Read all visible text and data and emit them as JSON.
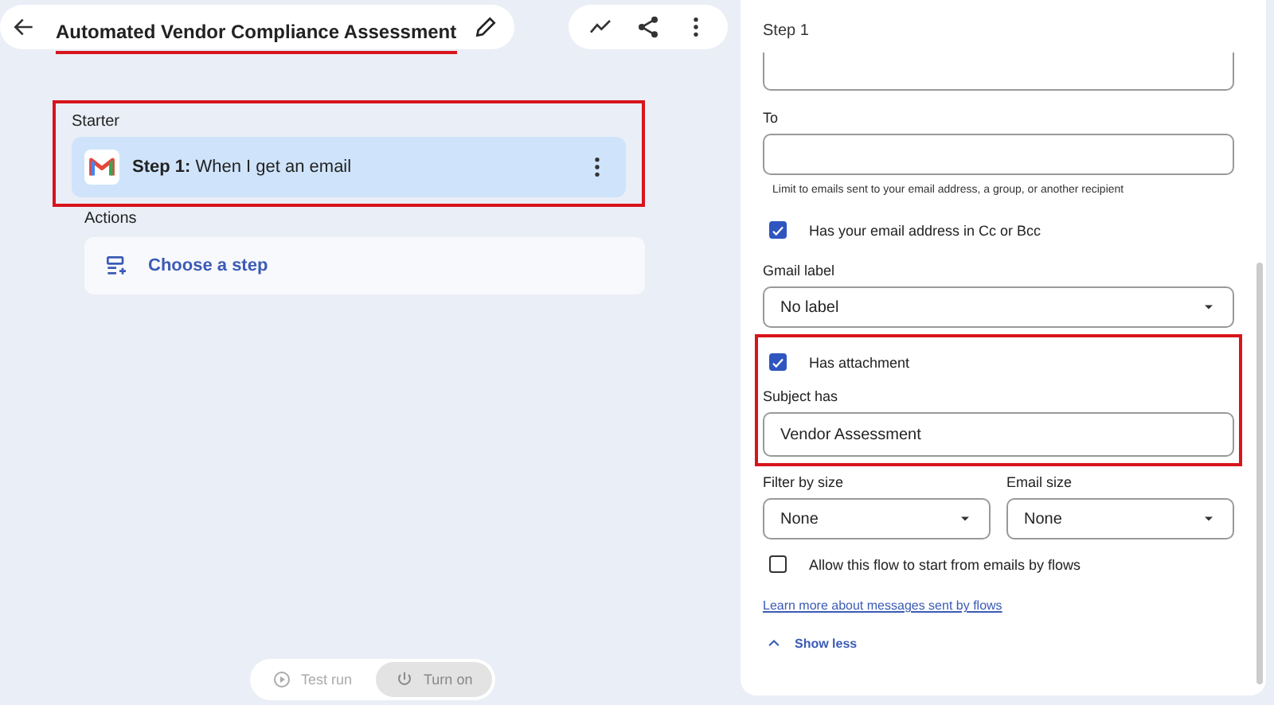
{
  "header": {
    "title": "Automated Vendor Compliance Assessment",
    "underlined": true
  },
  "starter": {
    "label": "Starter",
    "step": "**Step 1:** When I get an email",
    "highlighted": true
  },
  "actions": {
    "label": "Actions",
    "choose": "Choose a step"
  },
  "run_buttons": [
    {
      "label": "Test run",
      "kind": "play"
    },
    {
      "label": "Turn on",
      "kind": "power"
    }
  ],
  "panel": {
    "title": "Step 1",
    "items": [
      {
        "kind": "cut-field",
        "highlighted": false
      },
      {
        "kind": "text",
        "label": "To",
        "highlighted": false
      },
      {
        "kind": "hint",
        "text": "Limit to emails sent to your email address, a group, or another recipient",
        "highlighted": false
      },
      {
        "kind": "checkbox",
        "label": "Has your email address in Cc or Bcc",
        "checked": true,
        "highlighted": false
      },
      {
        "kind": "select",
        "label": "Gmail label",
        "value": "No label",
        "highlighted": false
      },
      {
        "kind": "checkbox",
        "label": "Has attachment",
        "checked": true,
        "highlighted": true
      },
      {
        "kind": "text",
        "label": "Subject has",
        "value": "Vendor Assessment",
        "highlighted": true
      },
      {
        "kind": "select-pair",
        "selects": [
          {
            "label": "Filter by size",
            "value": "None"
          },
          {
            "label": "Email size",
            "value": "None"
          }
        ],
        "highlighted": false
      },
      {
        "kind": "checkbox",
        "label": "Allow this flow to start from emails by flows",
        "checked": false,
        "highlighted": false
      },
      {
        "kind": "link",
        "text": "Learn more about messages sent by flows",
        "highlighted": false
      },
      {
        "kind": "toggle",
        "text": "Show less",
        "highlighted": false
      }
    ]
  }
}
